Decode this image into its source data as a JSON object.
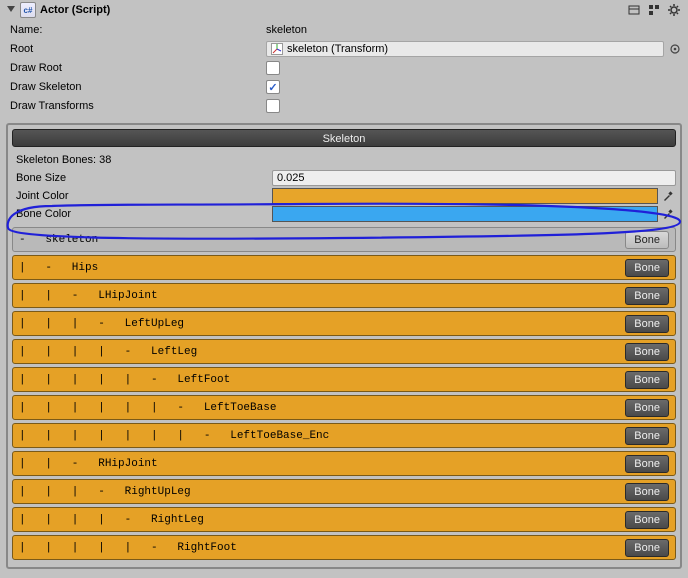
{
  "header": {
    "title": "Actor (Script)"
  },
  "fields": {
    "name_label": "Name:",
    "name_value": "skeleton",
    "root_label": "Root",
    "root_value": "skeleton (Transform)",
    "draw_root_label": "Draw Root",
    "draw_root_checked": false,
    "draw_skeleton_label": "Draw Skeleton",
    "draw_skeleton_checked": true,
    "draw_transforms_label": "Draw Transforms",
    "draw_transforms_checked": false
  },
  "panel": {
    "title": "Skeleton",
    "bone_count_label": "Skeleton Bones: 38",
    "bone_size_label": "Bone Size",
    "bone_size_value": "0.025",
    "joint_color_label": "Joint Color",
    "joint_color": "#e7a52a",
    "bone_color_label": "Bone Color",
    "bone_color": "#3aa7f0"
  },
  "bone_button_label": "Bone",
  "bones": [
    {
      "style": "grey",
      "text": "-   skeleton"
    },
    {
      "style": "orange",
      "text": "|   -   Hips"
    },
    {
      "style": "orange",
      "text": "|   |   -   LHipJoint"
    },
    {
      "style": "orange",
      "text": "|   |   |   -   LeftUpLeg"
    },
    {
      "style": "orange",
      "text": "|   |   |   |   -   LeftLeg"
    },
    {
      "style": "orange",
      "text": "|   |   |   |   |   -   LeftFoot"
    },
    {
      "style": "orange",
      "text": "|   |   |   |   |   |   -   LeftToeBase"
    },
    {
      "style": "orange",
      "text": "|   |   |   |   |   |   |   -   LeftToeBase_Enc"
    },
    {
      "style": "orange",
      "text": "|   |   -   RHipJoint"
    },
    {
      "style": "orange",
      "text": "|   |   |   -   RightUpLeg"
    },
    {
      "style": "orange",
      "text": "|   |   |   |   -   RightLeg"
    },
    {
      "style": "orange",
      "text": "|   |   |   |   |   -   RightFoot"
    }
  ]
}
